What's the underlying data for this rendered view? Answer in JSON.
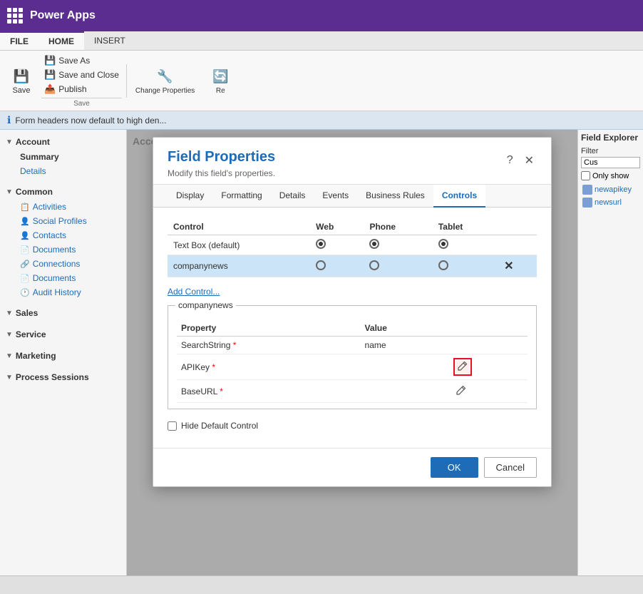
{
  "topbar": {
    "app_name": "Power Apps",
    "grid_icon_label": "apps-grid-icon"
  },
  "ribbon": {
    "tabs": [
      "FILE",
      "HOME",
      "INSERT"
    ],
    "active_tab": "HOME",
    "save_label": "Save",
    "save_as_label": "Save As",
    "save_close_label": "Save and Close",
    "publish_label": "Publish",
    "change_properties_label": "Change\nProperties",
    "group_label": "Save"
  },
  "info_bar": {
    "message": "Form headers now default to high den..."
  },
  "sidebar": {
    "sections": [
      {
        "header": "Account",
        "items": [
          {
            "label": "Summary",
            "active": true
          },
          {
            "label": "Details",
            "active": false
          }
        ]
      },
      {
        "header": "Common",
        "items": [
          {
            "label": "Activities",
            "icon": "📋"
          },
          {
            "label": "Social Profiles",
            "icon": "👤"
          },
          {
            "label": "Contacts",
            "icon": "👤"
          },
          {
            "label": "Documents",
            "icon": "📄"
          },
          {
            "label": "Connections",
            "icon": "🔗"
          },
          {
            "label": "Documents",
            "icon": "📄"
          },
          {
            "label": "Audit History",
            "icon": "🕐"
          }
        ]
      },
      {
        "header": "Sales",
        "items": []
      },
      {
        "header": "Service",
        "items": []
      },
      {
        "header": "Marketing",
        "items": []
      },
      {
        "header": "Process Sessions",
        "items": []
      }
    ]
  },
  "field_explorer": {
    "title": "Field Explorer",
    "filter_label": "Filter",
    "filter_placeholder": "Cus",
    "only_show_label": "Only show",
    "items": [
      {
        "label": "newapikey"
      },
      {
        "label": "newsurl"
      }
    ]
  },
  "modal": {
    "title": "Field Properties",
    "subtitle": "Modify this field's properties.",
    "help_btn": "?",
    "close_btn": "✕",
    "tabs": [
      "Display",
      "Formatting",
      "Details",
      "Events",
      "Business Rules",
      "Controls"
    ],
    "active_tab": "Controls",
    "controls_table": {
      "headers": [
        "Control",
        "Web",
        "Phone",
        "Tablet"
      ],
      "rows": [
        {
          "control": "Text Box (default)",
          "web_selected": true,
          "phone_selected": true,
          "tablet_selected": true,
          "selected_row": false
        },
        {
          "control": "companynews",
          "web_selected": false,
          "phone_selected": false,
          "tablet_selected": false,
          "selected_row": true,
          "has_remove": true
        }
      ]
    },
    "add_control_label": "Add Control...",
    "prop_group_legend": "companynews",
    "properties_table": {
      "headers": [
        "Property",
        "Value"
      ],
      "rows": [
        {
          "property": "SearchString",
          "required": true,
          "value": "name",
          "has_edit": false
        },
        {
          "property": "APIKey",
          "required": true,
          "value": "",
          "has_edit": true,
          "edit_highlighted": true
        },
        {
          "property": "BaseURL",
          "required": true,
          "value": "",
          "has_edit": true,
          "edit_highlighted": false
        }
      ]
    },
    "hide_default_label": "Hide Default Control",
    "ok_label": "OK",
    "cancel_label": "Cancel"
  },
  "account_summary": {
    "label": "Account Summary Details"
  },
  "bottom_bar": {
    "text": ""
  },
  "colors": {
    "accent": "#1e6bb8",
    "topbar_bg": "#5c2d91",
    "selected_row": "#cce4f7",
    "edit_highlight": "#e81123"
  }
}
